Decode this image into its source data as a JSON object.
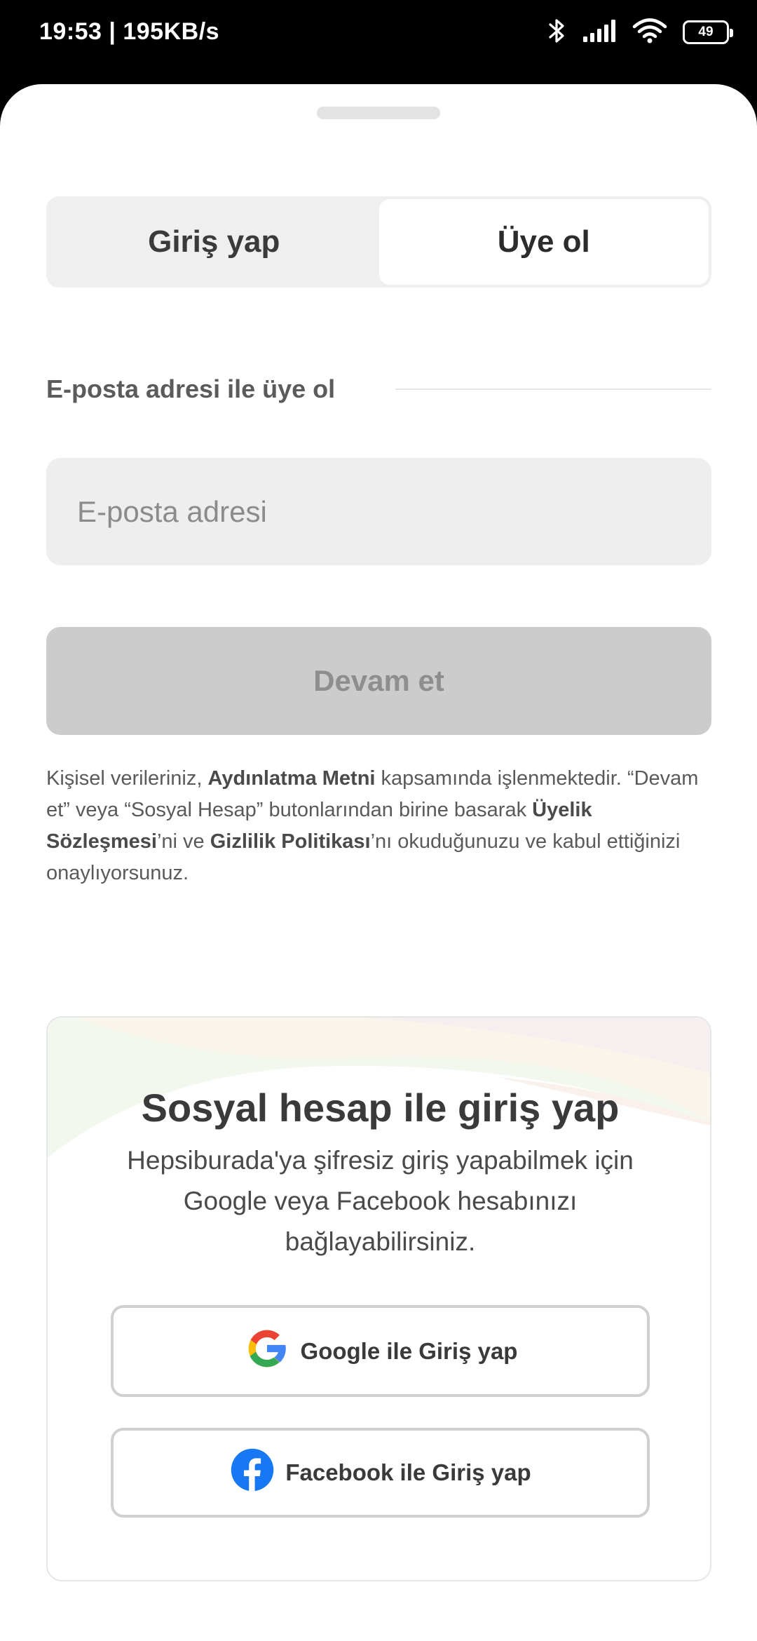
{
  "status_bar": {
    "time": "19:53 | 195KB/s",
    "icons": [
      "bluetooth-icon",
      "signal-icon",
      "wifi-icon",
      "battery-icon"
    ],
    "battery_level": "49"
  },
  "tabs": [
    {
      "label": "Giriş yap",
      "active": false
    },
    {
      "label": "Üye ol",
      "active": true
    }
  ],
  "signup": {
    "section_title": "E-posta adresi ile üye ol",
    "email_placeholder": "E-posta adresi",
    "email_value": "",
    "continue_label": "Devam et"
  },
  "legal": {
    "part1": "Kişisel verileriniz, ",
    "link1": "Aydınlatma Metni",
    "part2": " kapsamında işlenmektedir. “Devam et” veya “Sosyal Hesap” butonlarından birine basarak ",
    "link2": "Üyelik Sözleşmesi",
    "part3": "’ni ve ",
    "link3": "Gizlilik Politikası",
    "part4": "’nı okuduğunuzu ve kabul ettiğinizi onaylıyorsunuz."
  },
  "social": {
    "title": "Sosyal hesap ile giriş yap",
    "description": "Hepsiburada'ya şifresiz giriş yapabilmek için Google veya Facebook hesabınızı bağlayabilirsiniz.",
    "google_label": "Google ile Giriş yap",
    "facebook_label": "Facebook ile Giriş yap"
  },
  "colors": {
    "google_blue": "#4285F4",
    "google_red": "#EA4335",
    "google_yellow": "#FBBC05",
    "google_green": "#34A853",
    "facebook_blue": "#1877F2"
  }
}
